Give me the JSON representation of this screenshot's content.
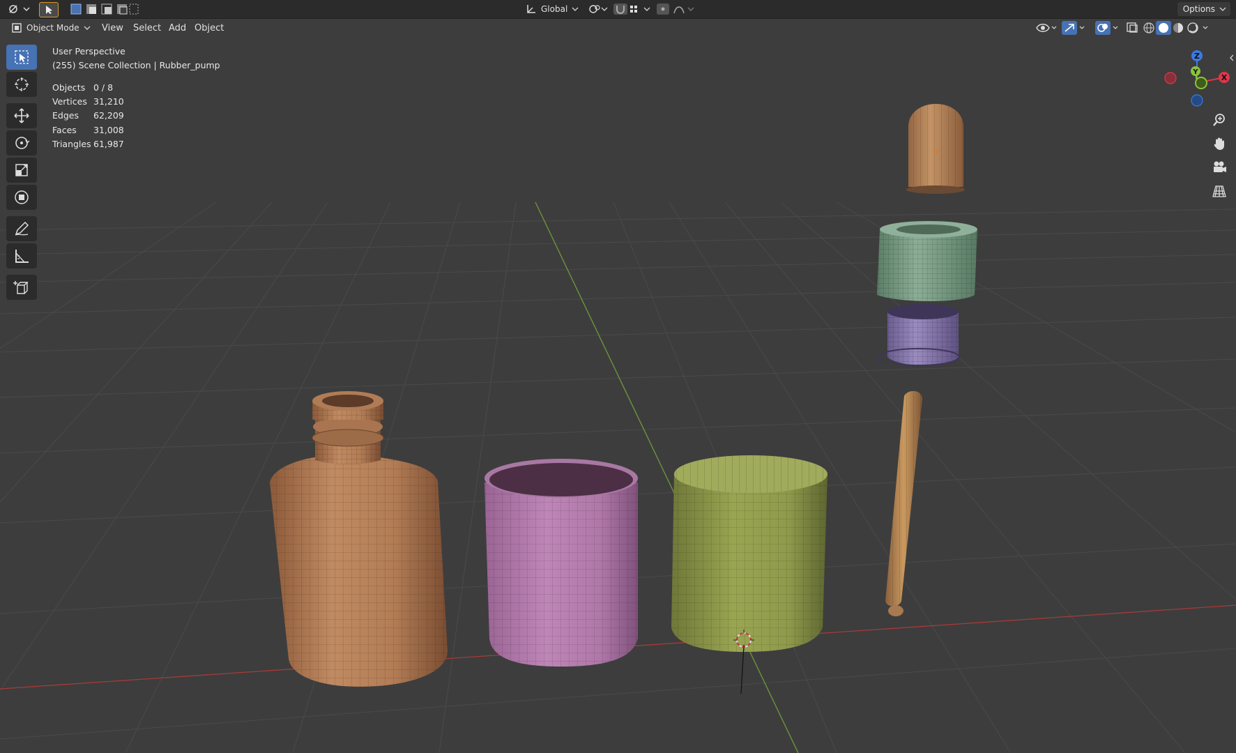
{
  "topbar": {
    "orientation_label": "Global",
    "options_label": "Options"
  },
  "header": {
    "mode_label": "Object Mode",
    "menus": [
      "View",
      "Select",
      "Add",
      "Object"
    ]
  },
  "viewport": {
    "view_name": "User Perspective",
    "collection_path": "(255) Scene Collection | Rubber_pump",
    "stats": [
      {
        "label": "Objects",
        "value": "0 / 8"
      },
      {
        "label": "Vertices",
        "value": "31,210"
      },
      {
        "label": "Edges",
        "value": "62,209"
      },
      {
        "label": "Faces",
        "value": "31,008"
      },
      {
        "label": "Triangles",
        "value": "61,987"
      }
    ]
  },
  "gizmo": {
    "axis_labels": {
      "x": "X",
      "y": "Y",
      "z": "Z"
    },
    "colors": {
      "x": "#e0374a",
      "y": "#8bc43a",
      "z": "#3c7ae0"
    }
  },
  "objects": [
    {
      "name": "bottle",
      "color": "#b9825a"
    },
    {
      "name": "pink-cylinder",
      "color": "#b47cae"
    },
    {
      "name": "green-cylinder",
      "color": "#8f9a4c"
    },
    {
      "name": "pump-head",
      "color": "#b9875a"
    },
    {
      "name": "green-collar",
      "color": "#7fa088"
    },
    {
      "name": "purple-cap",
      "color": "#8a7bae"
    },
    {
      "name": "dip-tube",
      "color": "#b88c5a"
    }
  ],
  "colors": {
    "background": "#3d3d3d",
    "active_tool": "#4772b3",
    "x_axis_line": "#a83a3a",
    "y_axis_line": "#6e9a3a"
  }
}
